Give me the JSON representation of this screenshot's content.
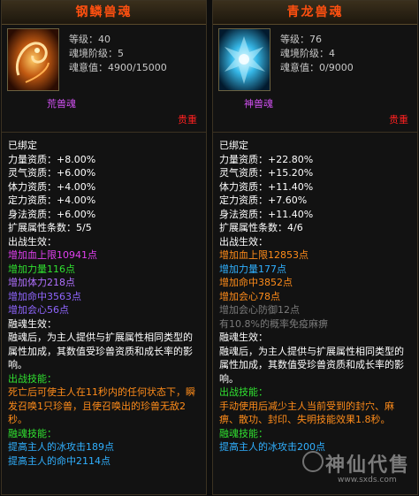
{
  "left": {
    "title": "钢鳞兽魂",
    "level": "等级：40",
    "tier": "魂境阶级：5",
    "soul": "魂意值：4900/15000",
    "grade": "荒兽魂",
    "rank": "贵重",
    "bound": "已绑定",
    "stats": [
      "力量资质：+8.00%",
      "灵气资质：+6.00%",
      "体力资质：+4.00%",
      "定力资质：+4.00%",
      "身法资质：+6.00%"
    ],
    "ext": "扩展属性条数：5/5",
    "battle_h": "出战生效：",
    "battle": [
      "增加血上限10941点",
      "增加力量116点",
      "增加体力218点",
      "增加命中3563点",
      "增加会心56点"
    ],
    "fuse_h": "融魂生效：",
    "fuse_desc": "融魂后，为主人提供与扩展属性相同类型的属性加成，其数值受珍兽资质和成长率的影响。",
    "skill_h": "出战技能：",
    "skill_desc": "死亡后可使主人在11秒内的任何状态下，瞬发召唤1只珍兽，且使召唤出的珍兽无敌2秒。",
    "fuse_skill_h": "融魂技能：",
    "fuse_skills": [
      "提高主人的冰攻击189点",
      "提高主人的命中2114点"
    ]
  },
  "right": {
    "title": "青龙兽魂",
    "level": "等级：76",
    "tier": "魂境阶级：4",
    "soul": "魂意值：0/9000",
    "grade": "神兽魂",
    "rank": "贵重",
    "bound": "已绑定",
    "stats": [
      "力量资质：+22.80%",
      "灵气资质：+15.20%",
      "体力资质：+11.40%",
      "定力资质：+7.60%",
      "身法资质：+11.40%"
    ],
    "ext": "扩展属性条数：4/6",
    "battle_h": "出战生效：",
    "battle": [
      "增加血上限12853点",
      "增加力量177点",
      "增加命中3852点",
      "增加会心78点",
      "增加会心防御12点",
      "有10.8%的概率免疫麻痹"
    ],
    "fuse_h": "融魂生效：",
    "fuse_desc": "融魂后，为主人提供与扩展属性相同类型的属性加成，其数值受珍兽资质和成长率的影响。",
    "skill_h": "出战技能：",
    "skill_desc": "手动使用后减少主人当前受到的封穴、麻痹、散功、封印、失明技能效果1.8秒。",
    "fuse_skill_h": "融魂技能：",
    "fuse_skills": [
      "提高主人的冰攻击200点"
    ]
  },
  "watermark": {
    "text": "神仙代售",
    "url": "www.sxds.com"
  },
  "colors": {
    "title": "#ff5010",
    "grade": "#d050f0",
    "rank": "#ff2020",
    "skill_text": "#ff8c1a"
  }
}
